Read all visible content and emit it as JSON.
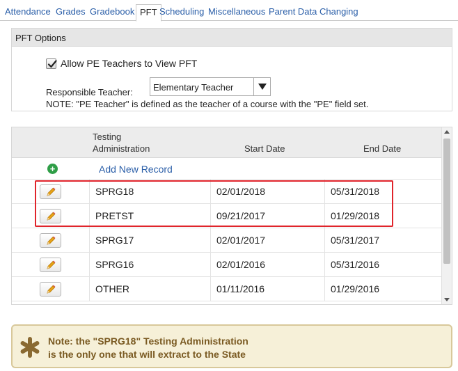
{
  "tabs": [
    {
      "label": "Attendance",
      "active": false
    },
    {
      "label": "Grades",
      "active": false
    },
    {
      "label": "Gradebook",
      "active": false
    },
    {
      "label": "PFT",
      "active": true
    },
    {
      "label": "Scheduling",
      "active": false
    },
    {
      "label": "Miscellaneous",
      "active": false
    },
    {
      "label": "Parent Data Changing",
      "active": false
    }
  ],
  "pft_options": {
    "header": "PFT Options",
    "allow_pe_label": "Allow PE Teachers to View PFT",
    "allow_pe_checked": true,
    "responsible_teacher_label": "Responsible Teacher:",
    "responsible_teacher_value": "Elementary Teacher",
    "note": "NOTE: \"PE Teacher\" is defined as the teacher of a course with the \"PE\" field set."
  },
  "table": {
    "columns": {
      "admin_line1": "Testing",
      "admin_line2": "Administration",
      "start": "Start Date",
      "end": "End Date"
    },
    "add_label": "Add New Record",
    "rows": [
      {
        "name": "SPRG18",
        "start": "02/01/2018",
        "end": "05/31/2018"
      },
      {
        "name": "PRETST",
        "start": "09/21/2017",
        "end": "01/29/2018"
      },
      {
        "name": "SPRG17",
        "start": "02/01/2017",
        "end": "05/31/2017"
      },
      {
        "name": "SPRG16",
        "start": "02/01/2016",
        "end": "05/31/2016"
      },
      {
        "name": "OTHER",
        "start": "01/11/2016",
        "end": "01/29/2016"
      }
    ]
  },
  "note_box": {
    "line1": "Note: the \"SPRG18\" Testing Administration",
    "line2": "is the only one that will extract to the State"
  },
  "colors": {
    "link": "#2a5ea8",
    "add_icon": "#2f9e47",
    "highlight": "#e0242b",
    "note_bg": "#f6f0d8",
    "note_text": "#7a5a22",
    "pencil": "#e8a317"
  }
}
